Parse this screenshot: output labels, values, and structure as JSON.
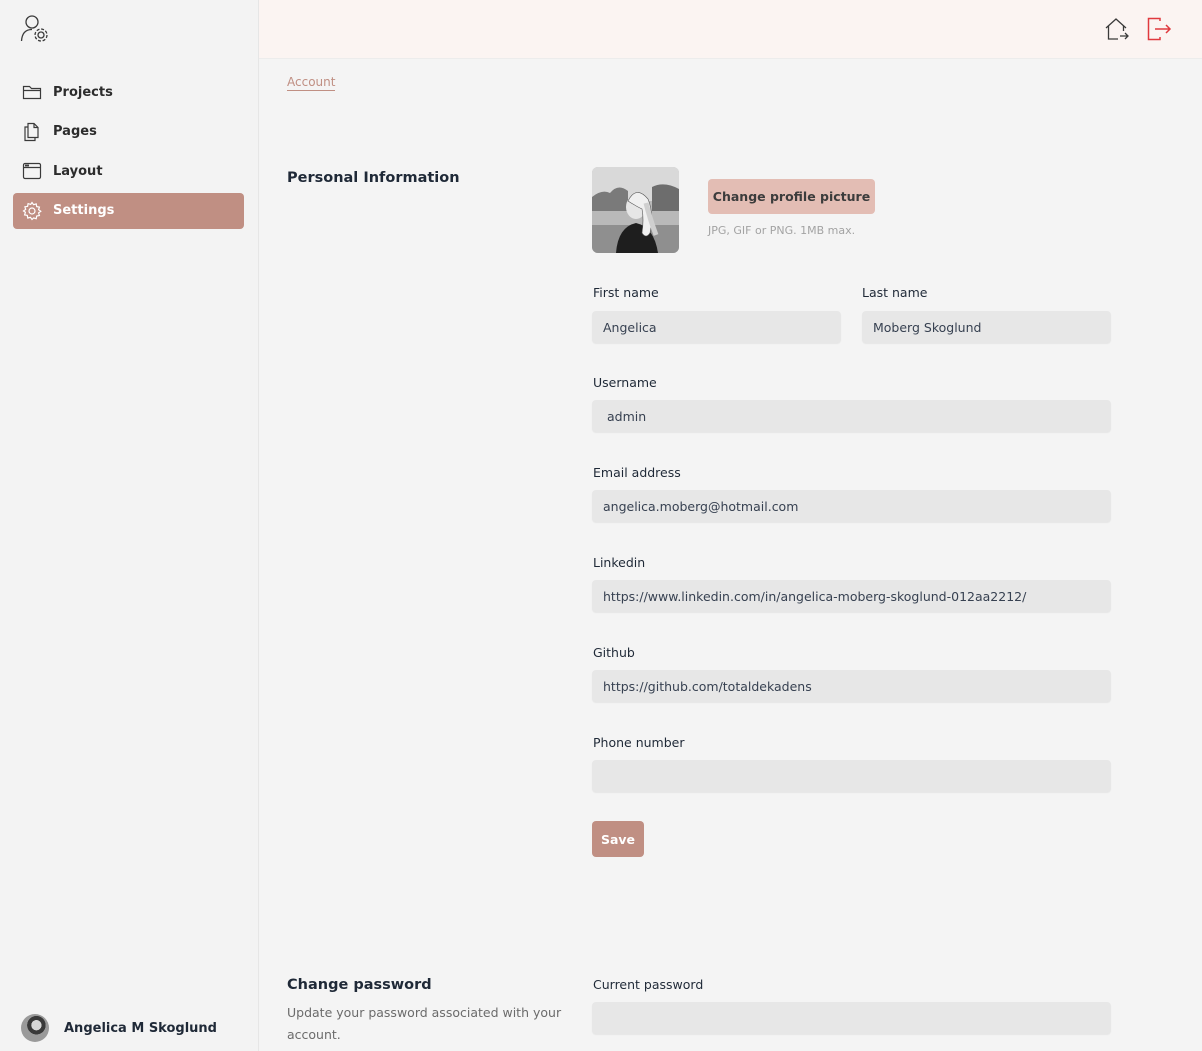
{
  "sidebar": {
    "items": [
      {
        "label": "Projects",
        "icon": "folder-icon"
      },
      {
        "label": "Pages",
        "icon": "pages-icon"
      },
      {
        "label": "Layout",
        "icon": "layout-icon"
      },
      {
        "label": "Settings",
        "icon": "gear-icon",
        "active": true
      }
    ],
    "user_name": "Angelica M Skoglund"
  },
  "topbar": {
    "icons": [
      "home-icon",
      "logout-icon"
    ]
  },
  "breadcrumb": "Account",
  "personal": {
    "title": "Personal Information",
    "change_picture_label": "Change profile picture",
    "picture_hint": "JPG, GIF or PNG. 1MB max.",
    "first_name_label": "First name",
    "first_name_value": "Angelica",
    "last_name_label": "Last name",
    "last_name_value": "Moberg Skoglund",
    "username_label": "Username",
    "username_value": " admin",
    "email_label": "Email address",
    "email_value": "angelica.moberg@hotmail.com",
    "linkedin_label": "Linkedin",
    "linkedin_value": "https://www.linkedin.com/in/angelica-moberg-skoglund-012aa2212/",
    "github_label": "Github",
    "github_value": "https://github.com/totaldekadens",
    "phone_label": "Phone number",
    "phone_value": "",
    "save_label": "Save"
  },
  "password": {
    "title": "Change password",
    "description": "Update your password associated with your account.",
    "current_label": "Current password",
    "current_value": ""
  },
  "colors": {
    "accent": "#c08f83",
    "accent_light": "#e3bdb4",
    "logout": "#e0393e",
    "topbar_bg": "#fbf4f2"
  }
}
